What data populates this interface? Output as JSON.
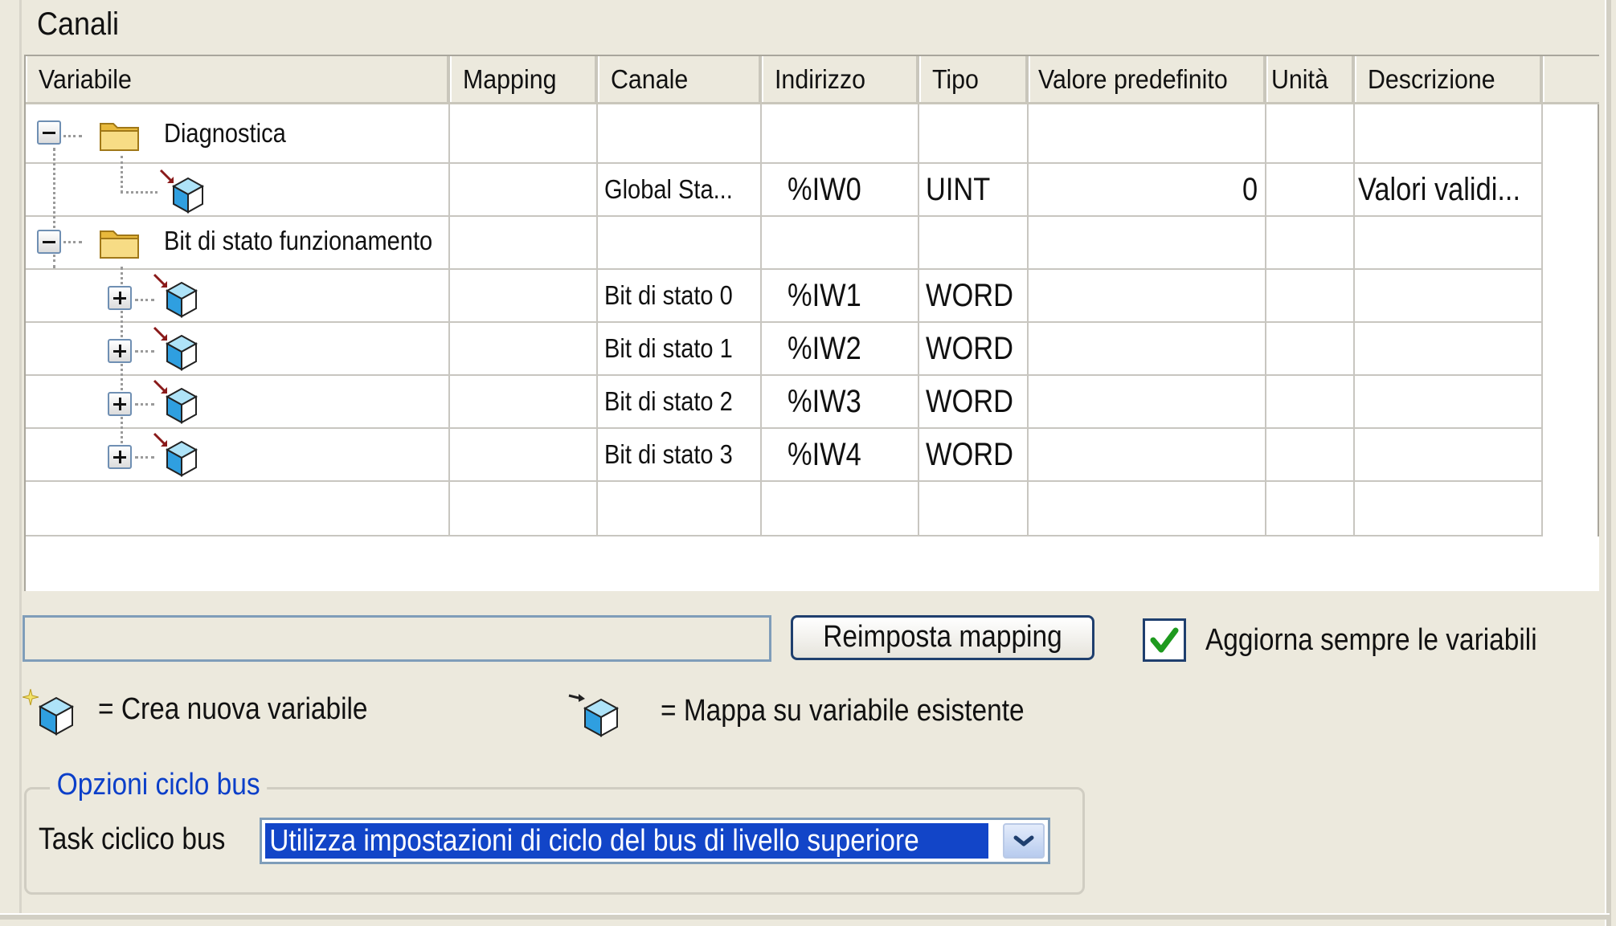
{
  "section": {
    "title": "Canali"
  },
  "table": {
    "columns": [
      "Variabile",
      "Mapping",
      "Canale",
      "Indirizzo",
      "Tipo",
      "Valore predefinito",
      "Unità",
      "Descrizione"
    ],
    "rows": [
      {
        "variable": "Diagnostica",
        "kind": "folder",
        "expander": "minus",
        "canale": "",
        "indirizzo": "",
        "tipo": "",
        "valore": "",
        "unita": "",
        "descrizione": ""
      },
      {
        "variable": "",
        "kind": "channel",
        "expander": "",
        "canale": "Global Sta...",
        "indirizzo": "%IW0",
        "tipo": "UINT",
        "valore": "0",
        "unita": "",
        "descrizione": "Valori validi..."
      },
      {
        "variable": "Bit di stato funzionamento",
        "kind": "folder",
        "expander": "minus",
        "canale": "",
        "indirizzo": "",
        "tipo": "",
        "valore": "",
        "unita": "",
        "descrizione": ""
      },
      {
        "variable": "",
        "kind": "channel",
        "expander": "plus",
        "canale": "Bit di stato 0",
        "indirizzo": "%IW1",
        "tipo": "WORD",
        "valore": "",
        "unita": "",
        "descrizione": ""
      },
      {
        "variable": "",
        "kind": "channel",
        "expander": "plus",
        "canale": "Bit di stato 1",
        "indirizzo": "%IW2",
        "tipo": "WORD",
        "valore": "",
        "unita": "",
        "descrizione": ""
      },
      {
        "variable": "",
        "kind": "channel",
        "expander": "plus",
        "canale": "Bit di stato 2",
        "indirizzo": "%IW3",
        "tipo": "WORD",
        "valore": "",
        "unita": "",
        "descrizione": ""
      },
      {
        "variable": "",
        "kind": "channel",
        "expander": "plus",
        "canale": "Bit di stato 3",
        "indirizzo": "%IW4",
        "tipo": "WORD",
        "valore": "",
        "unita": "",
        "descrizione": ""
      }
    ]
  },
  "actions": {
    "reset_mapping_label": "Reimposta mapping",
    "always_update_label": "Aggiorna sempre le variabili",
    "always_update_checked": true
  },
  "legend": {
    "new_variable": "= Crea nuova variabile",
    "map_existing": "= Mappa su variabile esistente",
    "new_variable_icon": "new-variable-cube-icon",
    "map_existing_icon": "map-existing-cube-icon"
  },
  "bus_options": {
    "group_title": "Opzioni ciclo bus",
    "task_label": "Task ciclico bus",
    "task_value": "Utilizza impostazioni di ciclo del bus di livello superiore"
  },
  "colors": {
    "background": "#ece9dd",
    "selection": "#1245c8",
    "group_title": "#0b3fc9",
    "check": "#1e9a1e"
  }
}
